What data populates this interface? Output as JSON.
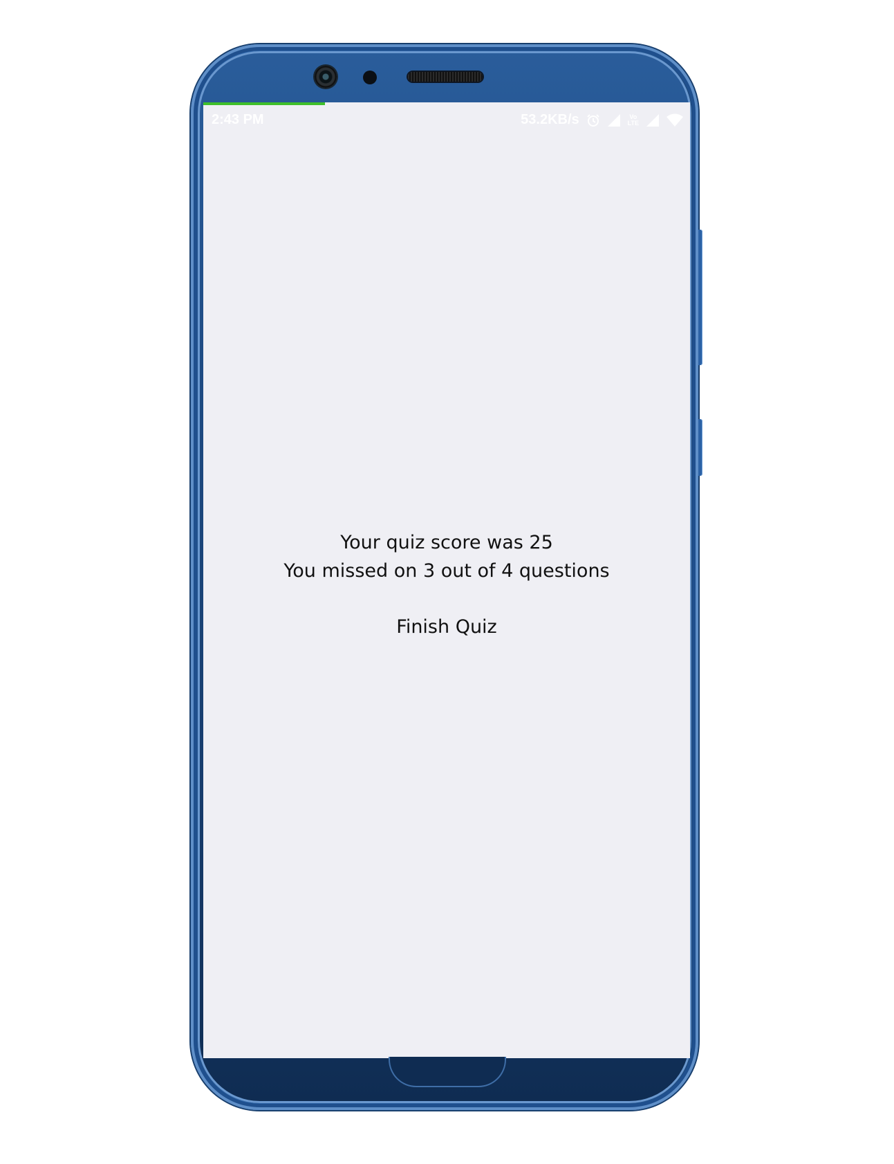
{
  "status_bar": {
    "time": "2:43 PM",
    "network_speed": "53.2KB/s",
    "volte_top": "Vo",
    "volte_bottom": "LTE",
    "icons": [
      "alarm-icon",
      "signal-icon",
      "volte-icon",
      "signal-icon",
      "wifi-icon"
    ]
  },
  "progress": {
    "fraction": 0.25,
    "color": "#3fbf2a"
  },
  "result": {
    "score_line": "Your quiz score was 25",
    "missed_line": "You missed on 3 out of 4 questions"
  },
  "actions": {
    "finish_label": "Finish Quiz"
  },
  "colors": {
    "phone_body": "#2a5d9d",
    "screen_background": "#efeff4"
  }
}
